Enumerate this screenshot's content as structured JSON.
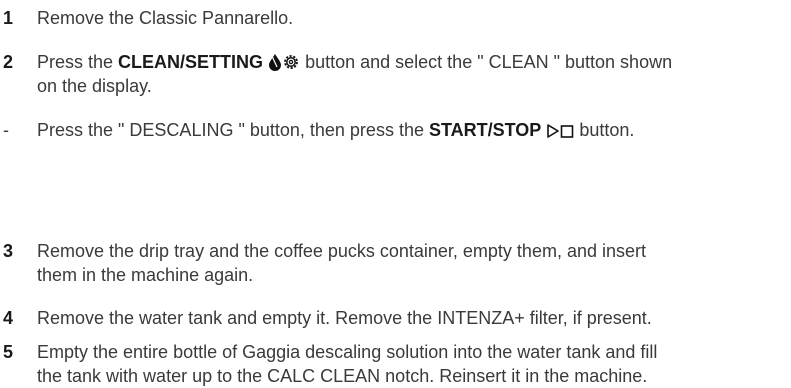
{
  "steps": [
    {
      "num": "1",
      "text": "Remove the Classic Pannarello."
    },
    {
      "num": "2",
      "pre": "Press the ",
      "bold": "CLEAN/SETTING",
      "icons": [
        "drop-icon",
        "gear-icon"
      ],
      "post_line1": " button and select the \" CLEAN \" button shown",
      "post_line2": "on the display."
    },
    {
      "num": "-",
      "pre": "Press the \" DESCALING \" button, then press the ",
      "bold": "START/STOP",
      "icons": [
        "play-icon",
        "stop-icon"
      ],
      "post": " button."
    },
    {
      "num": "3",
      "line1": "Remove the drip tray and the coffee pucks container, empty them, and insert",
      "line2": "them in the machine again."
    },
    {
      "num": "4",
      "text": "Remove the water tank and empty it. Remove the INTENZA+ filter, if present."
    },
    {
      "num": "5",
      "line1": "Empty the entire bottle of Gaggia descaling solution into the water tank and fill",
      "line2": "the tank with water up to the CALC CLEAN notch. Reinsert it in the machine."
    }
  ]
}
